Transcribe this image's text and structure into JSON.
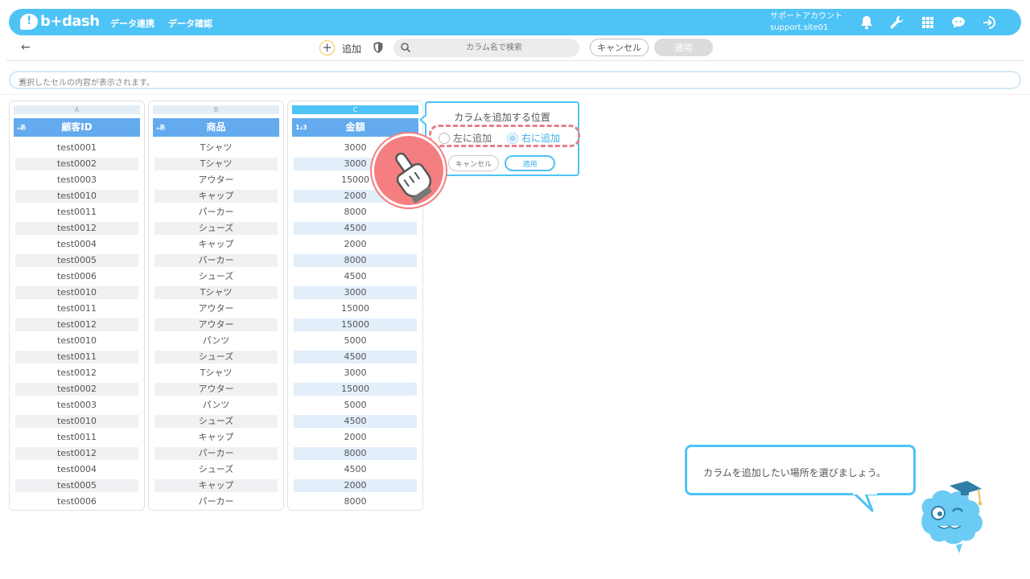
{
  "header": {
    "logo_text": "b+dash",
    "nav": [
      "データ連携",
      "データ確認"
    ],
    "account_name": "サポートアカウント",
    "account_id": "support.site01"
  },
  "toolbar": {
    "back": "←",
    "add_label": "追加",
    "search_placeholder": "カラム名で検索",
    "cancel": "キャンセル",
    "apply": "適用"
  },
  "cellbar": {
    "placeholder": "選択したセルの内容が表示されます。"
  },
  "columns": [
    {
      "letter": "A",
      "type": "ₐあ",
      "header": "顧客ID",
      "values": [
        "test0001",
        "test0002",
        "test0003",
        "test0010",
        "test0011",
        "test0012",
        "test0004",
        "test0005",
        "test0006",
        "test0010",
        "test0011",
        "test0012",
        "test0010",
        "test0011",
        "test0012",
        "test0002",
        "test0003",
        "test0010",
        "test0011",
        "test0012",
        "test0004",
        "test0005",
        "test0006"
      ]
    },
    {
      "letter": "B",
      "type": "ₐあ",
      "header": "商品",
      "values": [
        "Tシャツ",
        "Tシャツ",
        "アウター",
        "キャップ",
        "パーカー",
        "シューズ",
        "キャップ",
        "パーカー",
        "シューズ",
        "Tシャツ",
        "アウター",
        "アウター",
        "パンツ",
        "シューズ",
        "Tシャツ",
        "アウター",
        "パンツ",
        "シューズ",
        "キャップ",
        "パーカー",
        "シューズ",
        "キャップ",
        "パーカー"
      ]
    },
    {
      "letter": "C",
      "type": "1₂3",
      "header": "金額",
      "values": [
        "3000",
        "3000",
        "15000",
        "2000",
        "8000",
        "4500",
        "2000",
        "8000",
        "4500",
        "3000",
        "15000",
        "15000",
        "5000",
        "4500",
        "3000",
        "15000",
        "5000",
        "4500",
        "2000",
        "8000",
        "4500",
        "2000",
        "8000"
      ]
    }
  ],
  "popup": {
    "title": "カラムを追加する位置",
    "left_option": "左に追加",
    "right_option": "右に追加",
    "selected": "右に追加",
    "cancel": "キャンセル",
    "apply": "適用"
  },
  "tip": {
    "text": "カラムを追加したい場所を選びましょう。"
  },
  "colors": {
    "brand": "#4ec3f5",
    "column_header": "#63aaee",
    "highlight": "#e87e8a"
  }
}
